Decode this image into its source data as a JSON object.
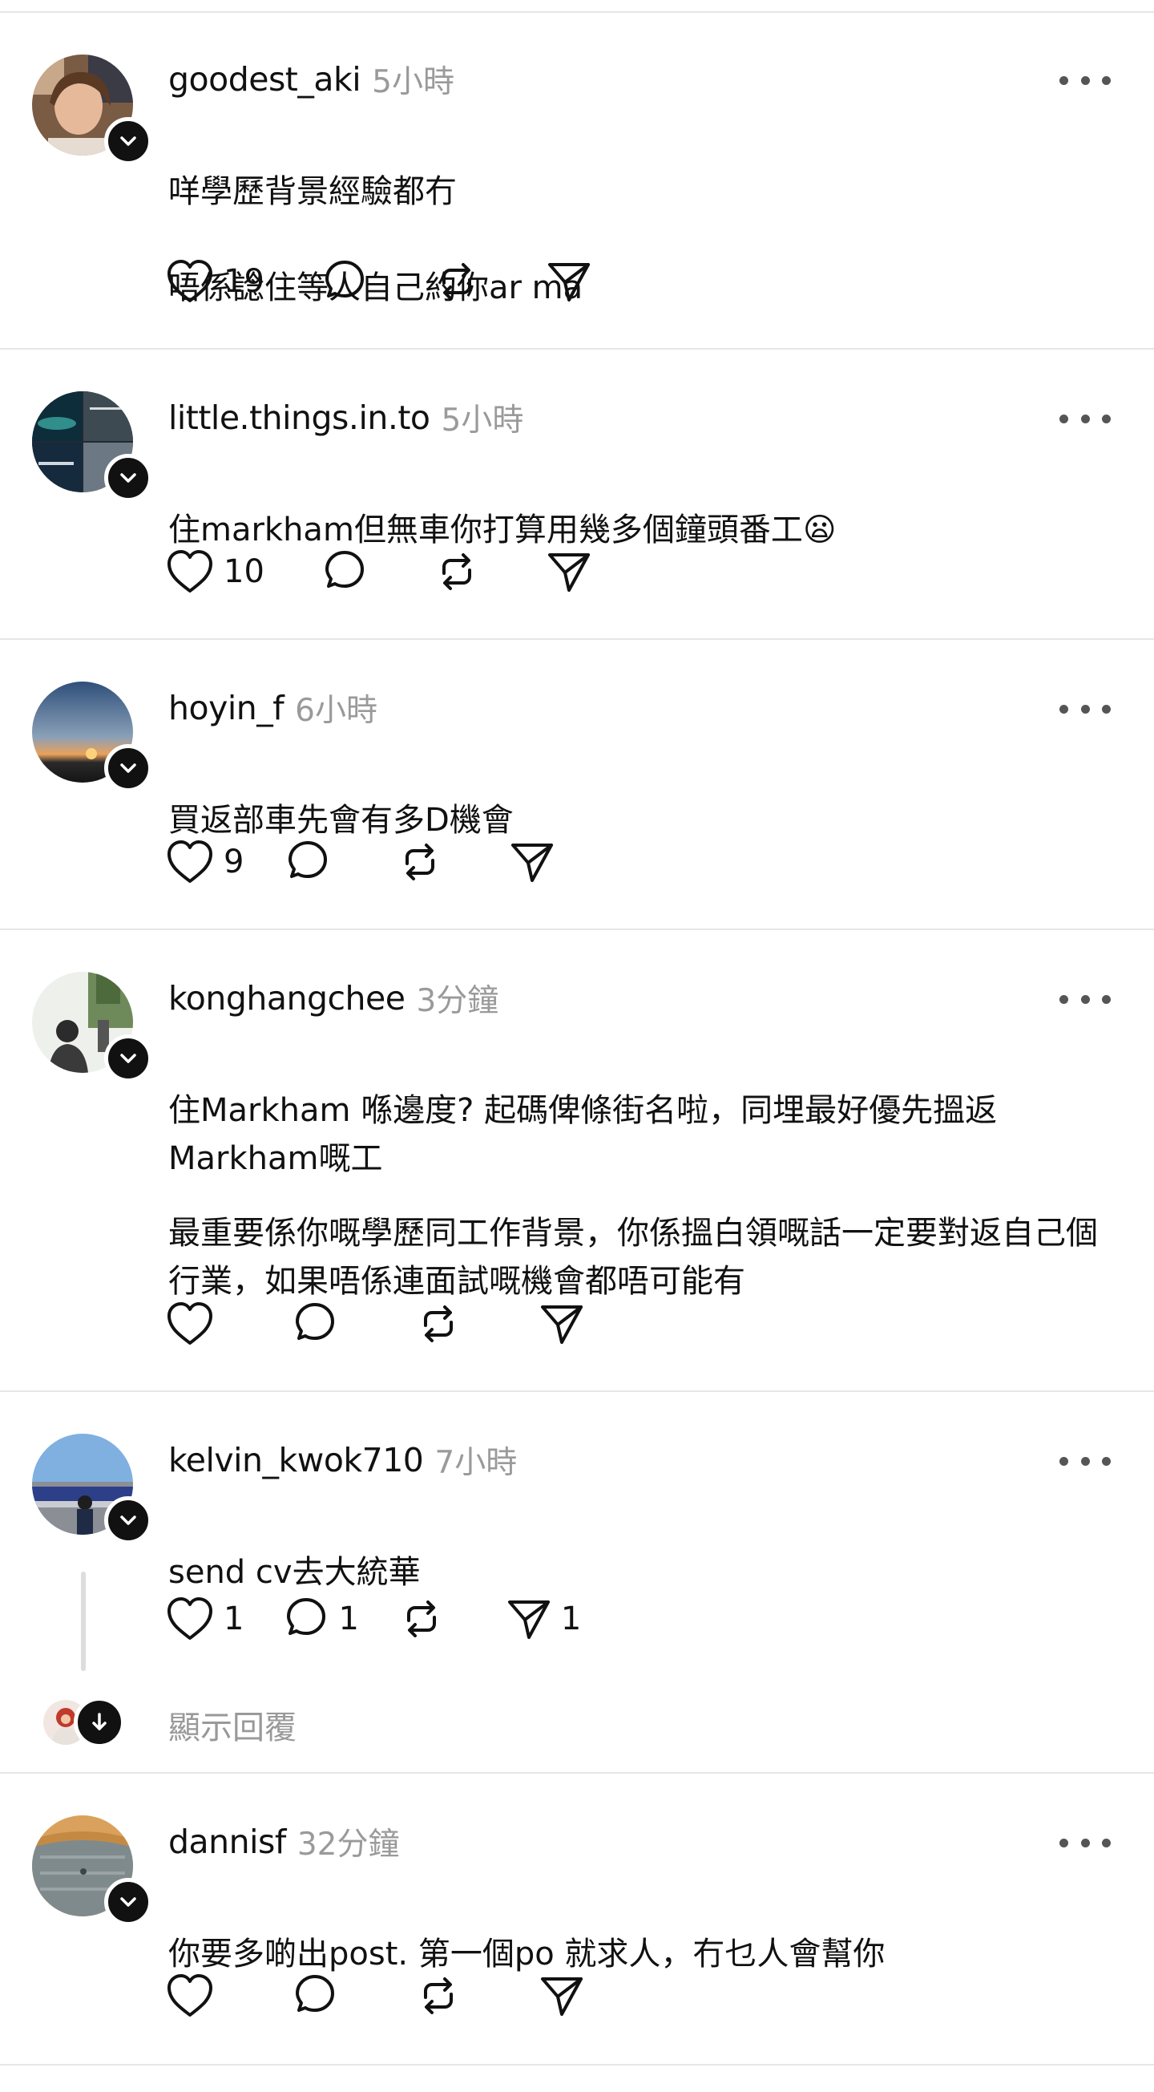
{
  "posts": [
    {
      "username": "goodest_aki",
      "time": "5小時",
      "lines": [
        "咩學歷背景經驗都冇",
        "唔係諗住等人自己約你ar ma"
      ],
      "likes": "19",
      "replies": "",
      "reposts": "",
      "shares": ""
    },
    {
      "username": "little.things.in.to",
      "time": "5小時",
      "text": "住markham但無車你打算用幾多個鐘頭番工",
      "emoji": "😦",
      "likes": "10",
      "replies": "",
      "reposts": "",
      "shares": ""
    },
    {
      "username": "hoyin_f",
      "time": "6小時",
      "text": "買返部車先會有多D機會",
      "likes": "9",
      "replies": "",
      "reposts": "",
      "shares": ""
    },
    {
      "username": "konghangchee",
      "time": "3分鐘",
      "paragraph1": "住Markham 喺邊度? 起碼俾條街名啦，同埋最好優先搵返Markham嘅工",
      "paragraph2": "最重要係你嘅學歷同工作背景，你係搵白領嘅話一定要對返自己個行業，如果唔係連面試嘅機會都唔可能有",
      "likes": "",
      "replies": "",
      "reposts": "",
      "shares": ""
    },
    {
      "username": "kelvin_kwok710",
      "time": "7小時",
      "text": "send cv去大統華",
      "likes": "1",
      "replies": "1",
      "reposts": "",
      "shares": "1",
      "show_replies_label": "顯示回覆"
    },
    {
      "username": "dannisf",
      "time": "32分鐘",
      "text": "你要多啲出post. 第一個po 就求人，冇乜人會幫你",
      "likes": "",
      "replies": "",
      "reposts": "",
      "shares": ""
    }
  ],
  "icons": {
    "like": "heart-icon",
    "reply": "comment-icon",
    "repost": "repost-icon",
    "share": "send-icon",
    "more": "more-horizontal-icon",
    "badge": "chevron-down-icon"
  },
  "colors": {
    "text": "#111111",
    "muted": "#9a9a9a",
    "divider": "#e6e6e6",
    "badge": "#111111"
  }
}
